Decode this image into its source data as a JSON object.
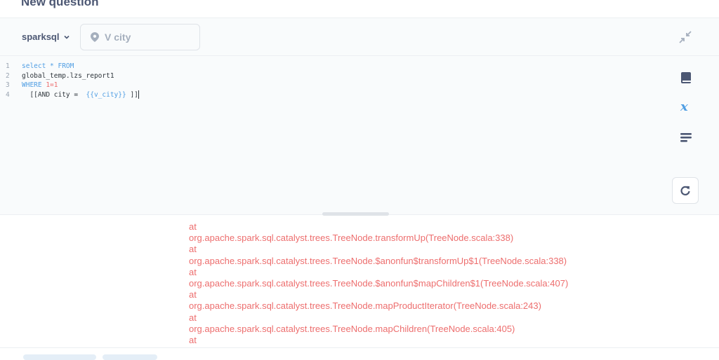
{
  "header": {
    "title": "New question"
  },
  "toolbar": {
    "database": "sparksql",
    "variable_placeholder": "V city",
    "variable_value": ""
  },
  "editor": {
    "lines": [
      {
        "number": "1",
        "tokens": [
          {
            "cls": "kw",
            "text": "select * FROM"
          }
        ]
      },
      {
        "number": "2",
        "tokens": [
          {
            "cls": "tx",
            "text": "global_temp.lzs_report1"
          }
        ]
      },
      {
        "number": "3",
        "tokens": [
          {
            "cls": "kw",
            "text": "WHERE "
          },
          {
            "cls": "num",
            "text": "1=1"
          }
        ]
      },
      {
        "number": "4",
        "tokens": [
          {
            "cls": "tx",
            "text": "  [[AND city =  "
          },
          {
            "cls": "var",
            "text": "{{v_city}}"
          },
          {
            "cls": "tx",
            "text": " ]]"
          }
        ]
      }
    ]
  },
  "sidebar_icons": [
    {
      "name": "data-reference-icon"
    },
    {
      "name": "variables-icon"
    },
    {
      "name": "snippets-icon"
    }
  ],
  "results": {
    "error_lines": [
      "at",
      "org.apache.spark.sql.catalyst.trees.TreeNode.transformUp(TreeNode.scala:338)",
      "at",
      "org.apache.spark.sql.catalyst.trees.TreeNode.$anonfun$transformUp$1(TreeNode.scala:338)",
      "at",
      "org.apache.spark.sql.catalyst.trees.TreeNode.$anonfun$mapChildren$1(TreeNode.scala:407)",
      "at",
      "org.apache.spark.sql.catalyst.trees.TreeNode.mapProductIterator(TreeNode.scala:243)",
      "at",
      "org.apache.spark.sql.catalyst.trees.TreeNode.mapChildren(TreeNode.scala:405)",
      "at"
    ]
  },
  "colors": {
    "brand": "#509ee3",
    "error": "#ed6e6e",
    "text_dark": "#4c5773"
  }
}
